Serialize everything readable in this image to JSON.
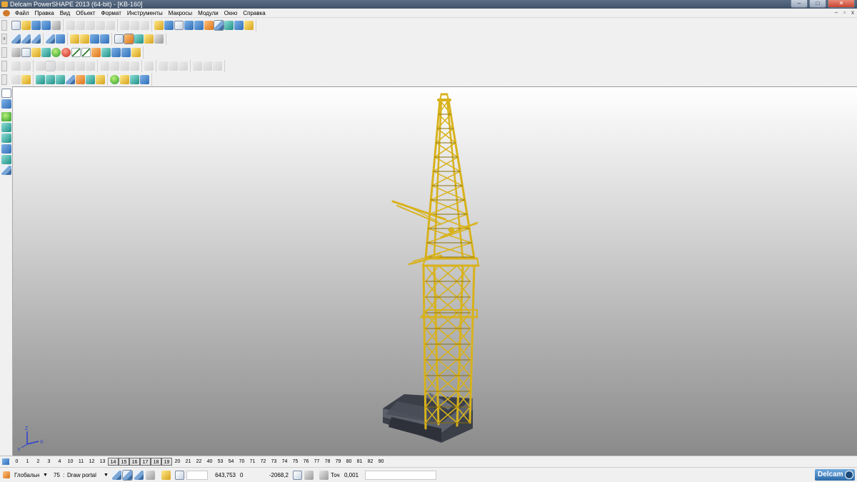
{
  "window": {
    "title": "Delcam PowerSHAPE 2013 (64-bit) - [KB-160]",
    "minimize": "–",
    "maximize": "□",
    "close": "✕"
  },
  "menu": {
    "items": [
      "Файл",
      "Правка",
      "Вид",
      "Объект",
      "Формат",
      "Инструменты",
      "Макросы",
      "Модули",
      "Окно",
      "Справка"
    ],
    "doc_minimize": "–",
    "doc_restore": "▫",
    "doc_close": "x"
  },
  "toolbars": {
    "grip": "x"
  },
  "viewport": {
    "model_name": "KB-160",
    "axis_labels": {
      "x": "X",
      "y": "Y",
      "z": "Z"
    },
    "colors": {
      "crane": "#d8b21c",
      "crane_shade": "#8f7208",
      "base": "#3b3f48",
      "base_light": "#5a5f6a"
    }
  },
  "levels": {
    "items": [
      "0",
      "1",
      "2",
      "3",
      "4",
      "10",
      "11",
      "12",
      "13",
      "14",
      "15",
      "16",
      "17",
      "18",
      "19",
      "20",
      "21",
      "22",
      "40",
      "53",
      "54",
      "70",
      "71",
      "72",
      "73",
      "74",
      "75",
      "76",
      "77",
      "78",
      "79",
      "80",
      "81",
      "82",
      "90"
    ],
    "active": [
      "14",
      "15",
      "16",
      "17",
      "18",
      "19"
    ]
  },
  "statusbar": {
    "workplane": "Глобальн",
    "level_number": "75",
    "level_name": "Draw portal",
    "coord_x": "643,753",
    "coord_y": "0",
    "coord_z": "-2068,2",
    "tolerance_label": "Точ",
    "tolerance_value": "0,001",
    "brand": "Delcam"
  }
}
